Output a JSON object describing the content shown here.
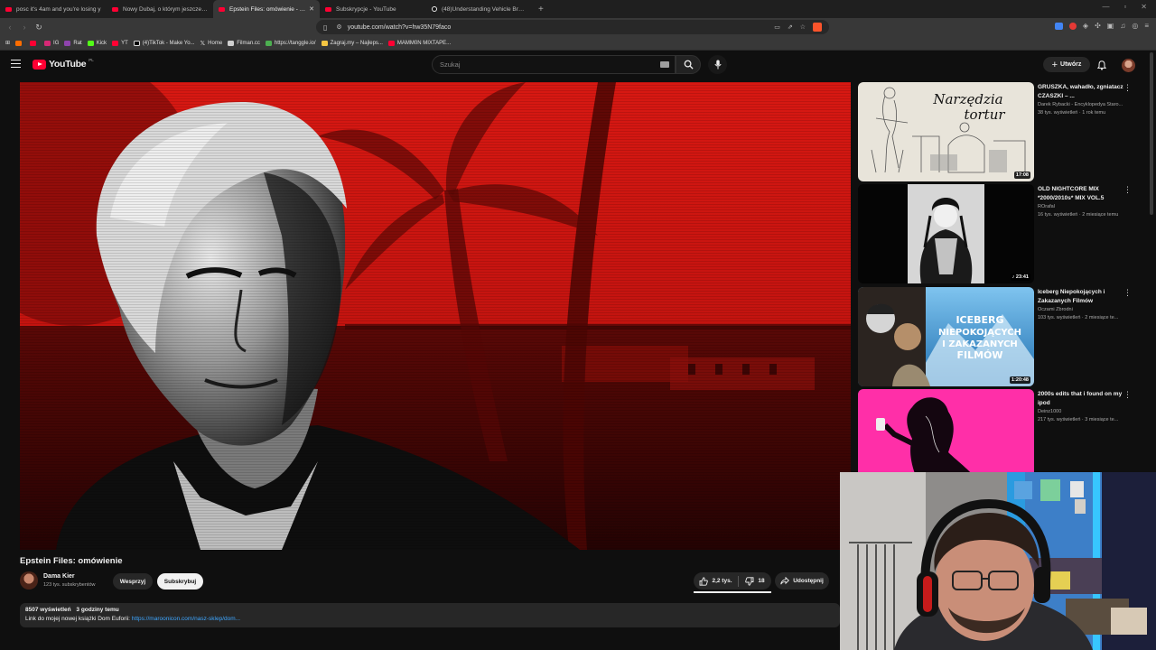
{
  "browser": {
    "tabs": [
      {
        "title": "posc it's 4am and you're losing y",
        "icon": "youtube-icon",
        "active": false
      },
      {
        "title": "Nowy Dubaj, o którym jeszcze nie sł",
        "icon": "youtube-icon",
        "active": false
      },
      {
        "title": "Epstein Files: omówienie - Yo",
        "icon": "youtube-icon",
        "active": true
      },
      {
        "title": "Subskrypcje - YouTube",
        "icon": "youtube-icon",
        "active": false
      },
      {
        "title": "(48)Understanding Vehicle Breakdow",
        "icon": "tiktok-icon",
        "active": false
      }
    ],
    "url": "youtube.com/watch?v=hw35N79faco",
    "bookmarks": [
      "",
      "",
      "IG",
      "Rat",
      "Kick",
      "YT",
      "(4)TikTok - Make Yo...",
      "Home",
      "Filman.cc",
      "https://tanggle.io/",
      "Zagraj.my – Najleps...",
      "MAMM0N MIXTAPE..."
    ]
  },
  "youtube": {
    "logo_text": "YouTube",
    "country_code": "PL",
    "search_placeholder": "Szukaj",
    "create_label": "Utwórz"
  },
  "video": {
    "title": "Epstein Files: omówienie",
    "channel": "Dama Kier",
    "subscribers": "123 tys. subskrybentów",
    "support_label": "Wesprzyj",
    "subscribe_label": "Subskrybuj",
    "likes": "2,2 tys.",
    "dislikes": "18",
    "share_label": "Udostępnij",
    "views": "8507 wyświetleń",
    "age": "3 godziny temu",
    "description_prefix": "Link do mojej nowej książki Dom Euforii: ",
    "description_link": "https://maroonicon.com/nasz-sklep/dom..."
  },
  "recommendations": [
    {
      "title": "GRUSZKA, wahadło, zgniatacz CZASZKI – ...",
      "channel": "Darek Rybacki - Encyklopedya Staro...",
      "meta": "38 tys. wyświetleń · 1 rok temu",
      "duration": "17:08",
      "thumb_text": [
        "Narzędzia",
        "tortur"
      ]
    },
    {
      "title": "OLD NIGHTCORE MIX *2000/2010s* MIX VOL.5",
      "channel": "ROrafal",
      "meta": "16 tys. wyświetleń · 2 miesiące temu",
      "duration": "♪ 23:41"
    },
    {
      "title": "Iceberg Niepokojących i Zakazanych Filmów",
      "channel": "Oczami Zbrodni",
      "meta": "103 tys. wyświetleń · 2 miesiące te...",
      "duration": "1:20:48",
      "thumb_text": [
        "ICEBERG",
        "NIEPOKOJĄCYCH",
        "I ZAKAZANYCH",
        "FILMÓW"
      ]
    },
    {
      "title": "2000s edits that i found on my ipod",
      "channel": "Deinz1000",
      "meta": "217 tys. wyświetleń · 3 miesiące te...",
      "duration": ""
    }
  ],
  "colors": {
    "accent_red": "#ff0033",
    "video_red": "#c81410",
    "link_blue": "#3ea6ff",
    "pink_thumb": "#ff2fa8"
  }
}
